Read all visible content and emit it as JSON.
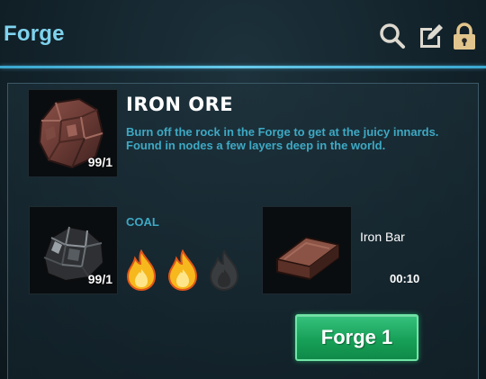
{
  "window": {
    "title": "Forge"
  },
  "toolbar": {
    "icons": [
      "search-icon",
      "edit-icon",
      "lock-icon"
    ]
  },
  "item": {
    "name": "IRON ORE",
    "description": "Burn off the rock in the Forge to get at the juicy innards. Found in nodes a few layers deep in the world.",
    "count": "99/1",
    "icon": "iron-ore-icon"
  },
  "fuel": {
    "label": "COAL",
    "count": "99/1",
    "icon": "coal-icon",
    "flames_lit": 2,
    "flames_total": 3
  },
  "output": {
    "name": "Iron Bar",
    "time": "00:10",
    "icon": "iron-bar-icon"
  },
  "action": {
    "forge_label": "Forge 1"
  },
  "colors": {
    "accent": "#7fd3ee",
    "description_text": "#3ea9c4",
    "button": "#17a058",
    "flame": "#f6b81c"
  }
}
